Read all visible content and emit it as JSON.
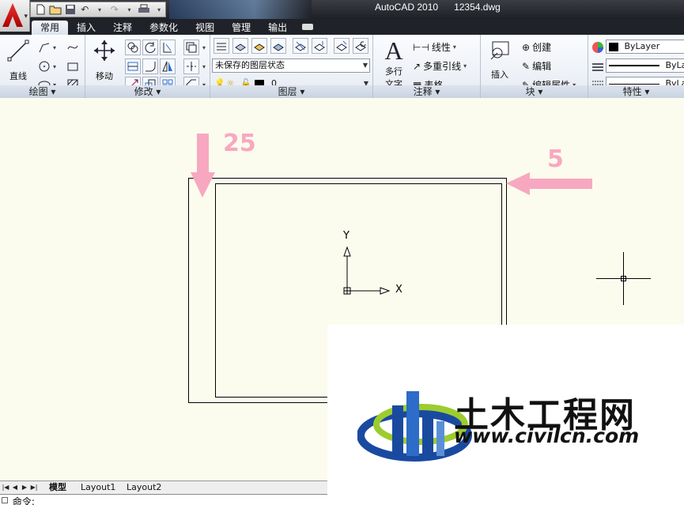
{
  "title": {
    "app": "AutoCAD 2010",
    "file": "12354.dwg"
  },
  "tabs": [
    "常用",
    "插入",
    "注释",
    "参数化",
    "视图",
    "管理",
    "输出"
  ],
  "ribbon": {
    "draw": {
      "line_label": "直线",
      "title": "绘图 ▾"
    },
    "modify": {
      "move_label": "移动",
      "title": "修改 ▾"
    },
    "layers": {
      "state_combo": "未保存的图层状态",
      "layer_combo": "0",
      "title": "图层 ▾"
    },
    "annotation": {
      "mtext_label_1": "多行",
      "mtext_label_2": "文字",
      "linear": "线性",
      "multileader": "多重引线",
      "table": "表格",
      "title": "注释 ▾"
    },
    "block": {
      "insert_label": "插入",
      "create": "创建",
      "edit": "编辑",
      "edit_attr": "编辑属性",
      "title": "块 ▾"
    },
    "properties": {
      "color": "ByLayer",
      "linetype": "ByLayer",
      "lineweight": "ByLayer",
      "title": "特性 ▾"
    }
  },
  "drawing": {
    "annotation_left": "25",
    "annotation_right": "5",
    "ucs_x": "X",
    "ucs_y": "Y",
    "accent_color": "#f7a8c0"
  },
  "layout_tabs": [
    "模型",
    "Layout1",
    "Layout2"
  ],
  "command": {
    "prompt": "命令:"
  },
  "watermark": {
    "brand": "土木工程网",
    "url": "www.civilcn.com"
  }
}
